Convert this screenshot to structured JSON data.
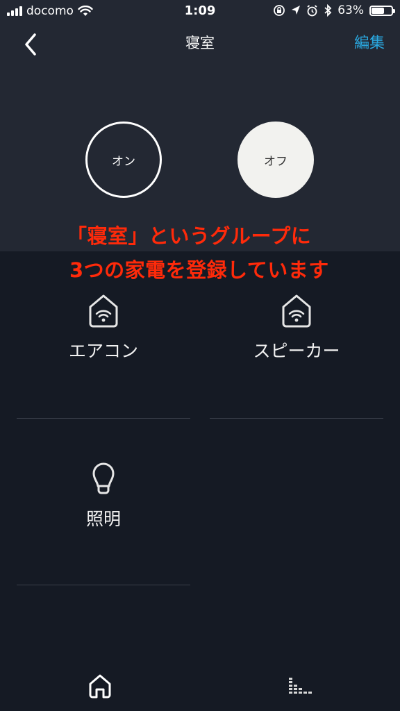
{
  "status_bar": {
    "carrier": "docomo",
    "time": "1:09",
    "battery_percent": "63%",
    "battery_level": 0.63
  },
  "nav": {
    "title": "寝室",
    "edit_label": "編集"
  },
  "power": {
    "on_label": "オン",
    "off_label": "オフ"
  },
  "annotation": {
    "line1": "「寝室」というグループに",
    "line2": "3つの家電を登録しています",
    "color": "#ff2a0a"
  },
  "devices": [
    {
      "label": "エアコン",
      "icon": "smart-home-icon"
    },
    {
      "label": "スピーカー",
      "icon": "smart-home-icon"
    },
    {
      "label": "照明",
      "icon": "light-bulb-icon"
    }
  ],
  "tabs": [
    {
      "icon": "home-icon"
    },
    {
      "icon": "activity-icon"
    }
  ],
  "colors": {
    "accent": "#2aa8e0",
    "background": "#151a24",
    "header_background": "#232833"
  }
}
